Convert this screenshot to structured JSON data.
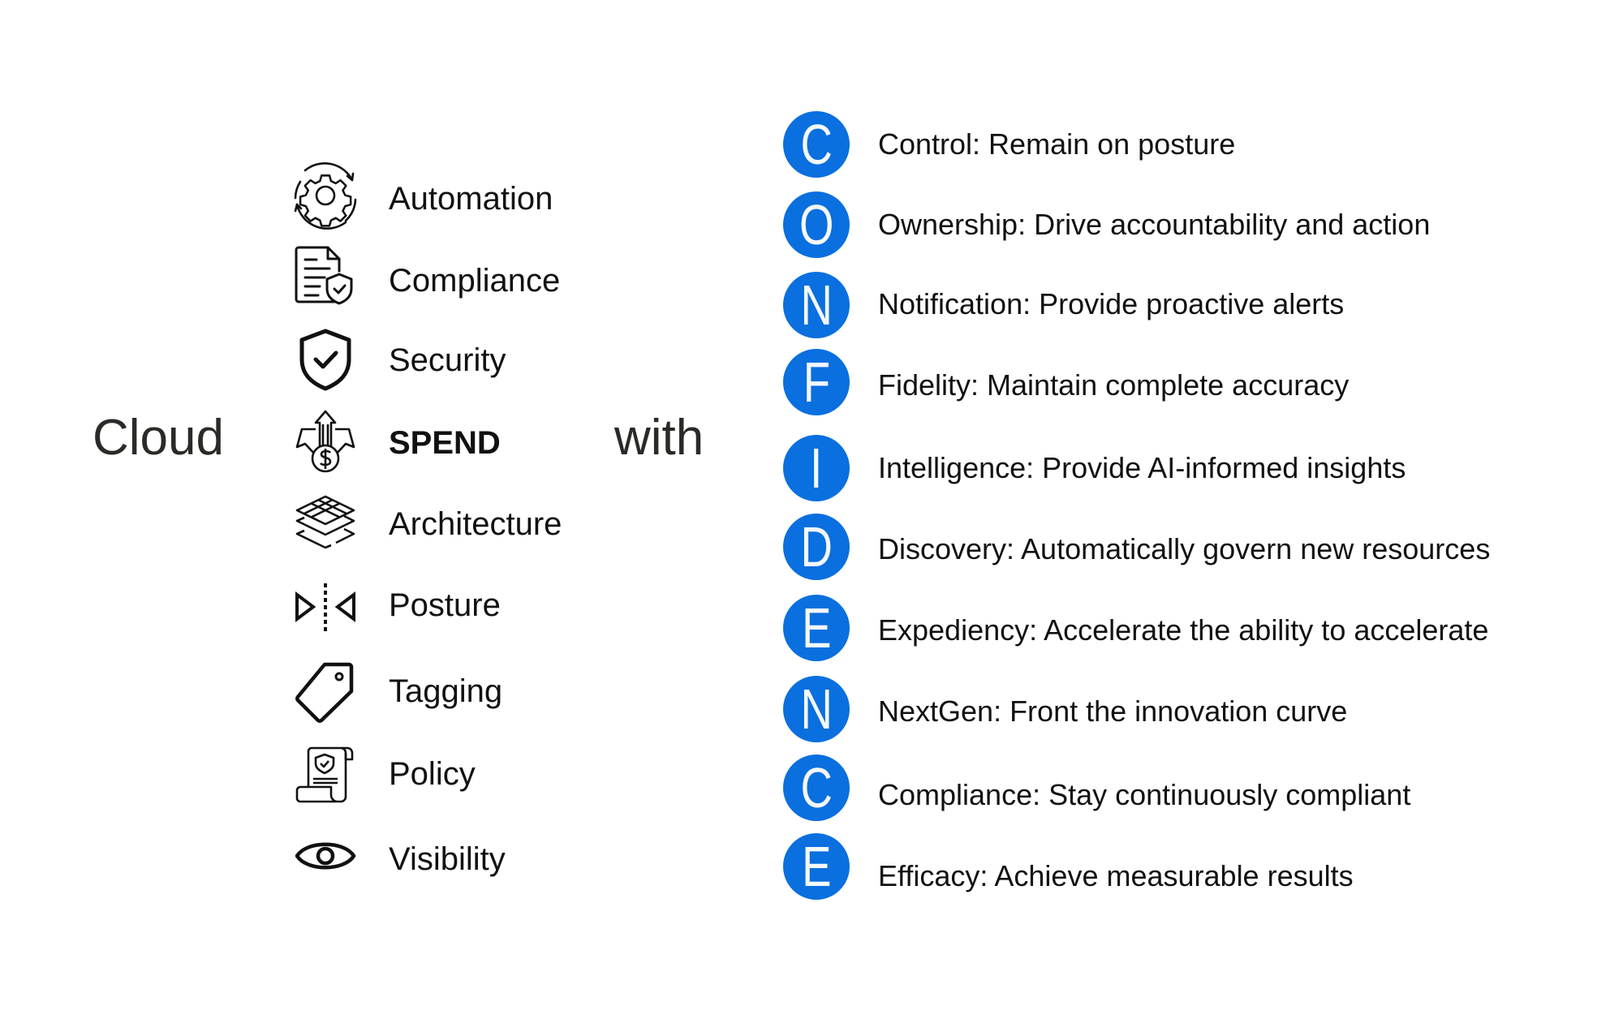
{
  "heading": {
    "prefix": "Cloud",
    "connector": "with"
  },
  "pillars": [
    {
      "label": "Automation",
      "icon": "gear-cycle-icon",
      "emphasis": false
    },
    {
      "label": "Compliance",
      "icon": "document-shield-icon",
      "emphasis": false
    },
    {
      "label": "Security",
      "icon": "shield-check-icon",
      "emphasis": false
    },
    {
      "label": "SPEND",
      "icon": "money-spend-arrows-icon",
      "emphasis": true
    },
    {
      "label": "Architecture",
      "icon": "layers-icon",
      "emphasis": false
    },
    {
      "label": "Posture",
      "icon": "symmetry-icon",
      "emphasis": false
    },
    {
      "label": "Tagging",
      "icon": "tag-icon",
      "emphasis": false
    },
    {
      "label": "Policy",
      "icon": "policy-scroll-icon",
      "emphasis": false
    },
    {
      "label": "Visibility",
      "icon": "eye-icon",
      "emphasis": false
    }
  ],
  "acronym": {
    "word": "CONFIDENCE",
    "accent_color": "#0a6fdf",
    "items": [
      {
        "letter": "C",
        "text": "Control: Remain on posture"
      },
      {
        "letter": "O",
        "text": "Ownership: Drive accountability and action"
      },
      {
        "letter": "N",
        "text": "Notification: Provide proactive alerts"
      },
      {
        "letter": "F",
        "text": "Fidelity: Maintain complete accuracy"
      },
      {
        "letter": "I",
        "text": "Intelligence: Provide AI-informed insights"
      },
      {
        "letter": "D",
        "text": "Discovery: Automatically govern new resources"
      },
      {
        "letter": "E",
        "text": "Expediency: Accelerate the ability to accelerate"
      },
      {
        "letter": "N",
        "text": "NextGen: Front the innovation curve"
      },
      {
        "letter": "C",
        "text": "Compliance: Stay continuously compliant"
      },
      {
        "letter": "E",
        "text": "Efficacy: Achieve measurable results"
      }
    ]
  }
}
